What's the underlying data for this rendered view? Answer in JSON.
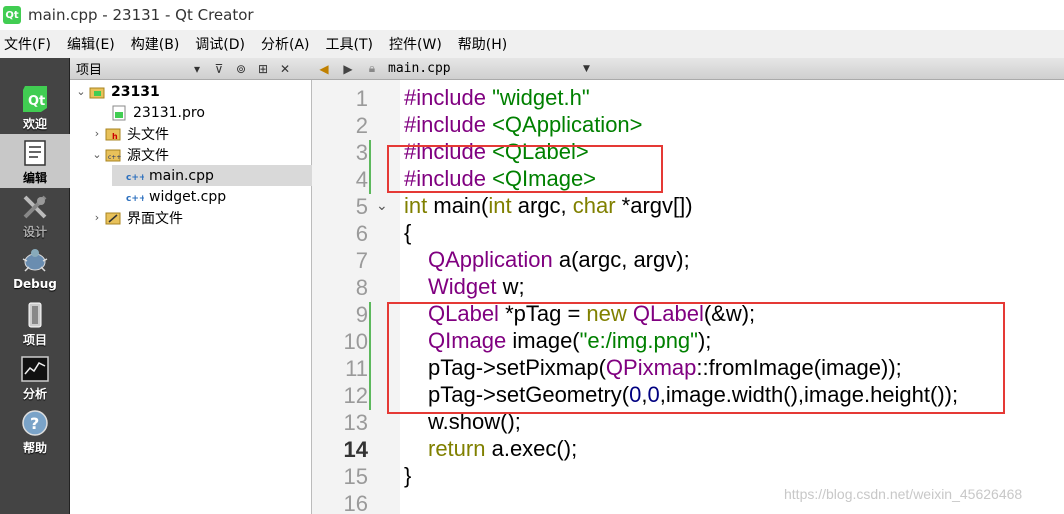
{
  "window": {
    "app_icon_text": "Qt",
    "title": "main.cpp - 23131 - Qt Creator"
  },
  "menu": [
    "文件(F)",
    "编辑(E)",
    "构建(B)",
    "调试(D)",
    "分析(A)",
    "工具(T)",
    "控件(W)",
    "帮助(H)"
  ],
  "modes": [
    {
      "label": "欢迎",
      "icon": "qt-logo-icon"
    },
    {
      "label": "编辑",
      "icon": "edit-document-icon"
    },
    {
      "label": "设计",
      "icon": "design-tools-icon"
    },
    {
      "label": "Debug",
      "icon": "debug-bug-icon"
    },
    {
      "label": "项目",
      "icon": "project-wrench-icon"
    },
    {
      "label": "分析",
      "icon": "analyze-chart-icon"
    },
    {
      "label": "帮助",
      "icon": "help-question-icon"
    }
  ],
  "project_panel": {
    "title": "项目",
    "tree": [
      {
        "label": "23131",
        "icon": "project-folder-icon",
        "expanded": true
      },
      {
        "label": "23131.pro",
        "icon": "pro-file-icon"
      },
      {
        "label": "头文件",
        "icon": "headers-folder-icon",
        "expanded": false
      },
      {
        "label": "源文件",
        "icon": "sources-folder-icon",
        "expanded": true
      },
      {
        "label": "main.cpp",
        "icon": "cpp-file-icon",
        "selected": true
      },
      {
        "label": "widget.cpp",
        "icon": "cpp-file-icon"
      },
      {
        "label": "界面文件",
        "icon": "forms-folder-icon",
        "expanded": false
      }
    ]
  },
  "editor": {
    "file_tab": "main.cpp",
    "current_line": "14",
    "line_numbers": [
      "1",
      "2",
      "3",
      "4",
      "5",
      "6",
      "7",
      "8",
      "9",
      "10",
      "11",
      "12",
      "13",
      "14",
      "15",
      "16"
    ],
    "lines": [
      [
        {
          "t": "#include ",
          "c": "ty"
        },
        {
          "t": "\"widget.h\"",
          "c": "st"
        }
      ],
      [
        {
          "t": "#include ",
          "c": "ty"
        },
        {
          "t": "<QApplication>",
          "c": "st"
        }
      ],
      [
        {
          "t": "#include ",
          "c": "ty"
        },
        {
          "t": "<QLabel>",
          "c": "st"
        }
      ],
      [
        {
          "t": "#include ",
          "c": "ty"
        },
        {
          "t": "<QImage>",
          "c": "st"
        }
      ],
      [
        {
          "t": "int",
          "c": "kw"
        },
        {
          "t": " main(",
          "c": ""
        },
        {
          "t": "int",
          "c": "kw"
        },
        {
          "t": " argc, ",
          "c": ""
        },
        {
          "t": "char",
          "c": "kw"
        },
        {
          "t": " *argv[])",
          "c": ""
        }
      ],
      [
        {
          "t": "{",
          "c": ""
        }
      ],
      [
        {
          "t": "QApplication",
          "c": "ty"
        },
        {
          "t": " a(argc, argv);",
          "c": ""
        }
      ],
      [
        {
          "t": "Widget",
          "c": "ty"
        },
        {
          "t": " w;",
          "c": ""
        }
      ],
      [
        {
          "t": "QLabel",
          "c": "ty"
        },
        {
          "t": " *pTag = ",
          "c": ""
        },
        {
          "t": "new",
          "c": "kw"
        },
        {
          "t": " ",
          "c": ""
        },
        {
          "t": "QLabel",
          "c": "ty"
        },
        {
          "t": "(&w);",
          "c": ""
        }
      ],
      [
        {
          "t": "QImage",
          "c": "ty"
        },
        {
          "t": " image(",
          "c": ""
        },
        {
          "t": "\"e:/img.png\"",
          "c": "st"
        },
        {
          "t": ");",
          "c": ""
        }
      ],
      [
        {
          "t": "pTag->setPixmap(",
          "c": ""
        },
        {
          "t": "QPixmap",
          "c": "ty"
        },
        {
          "t": "::fromImage(image));",
          "c": ""
        }
      ],
      [
        {
          "t": "pTag->setGeometry(",
          "c": ""
        },
        {
          "t": "0",
          "c": "nu"
        },
        {
          "t": ",",
          "c": ""
        },
        {
          "t": "0",
          "c": "nu"
        },
        {
          "t": ",image.width(),image.height());",
          "c": ""
        }
      ],
      [
        {
          "t": "w.show();",
          "c": ""
        }
      ],
      [
        {
          "t": "return",
          "c": "kw"
        },
        {
          "t": " a.exec();",
          "c": ""
        }
      ],
      [
        {
          "t": "}",
          "c": ""
        }
      ],
      []
    ]
  },
  "watermark": "https://blog.csdn.net/weixin_45626468",
  "colors": {
    "highlight_box": "#e53935",
    "keyword": "#808000",
    "type": "#800080",
    "string": "#008000",
    "number": "#000080"
  }
}
